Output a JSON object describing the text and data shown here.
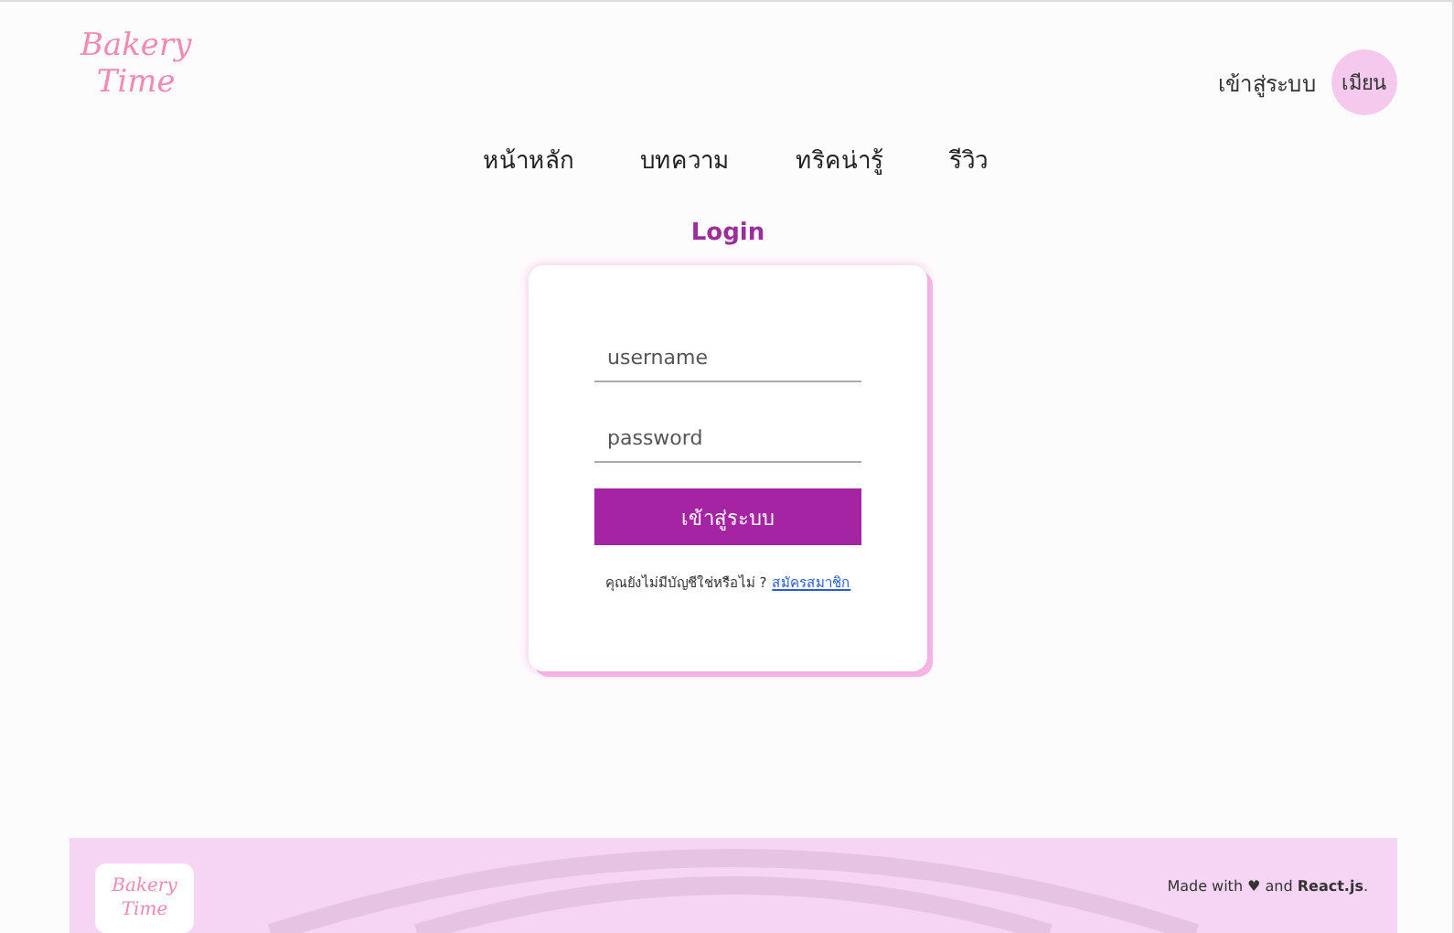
{
  "header": {
    "logo": [
      "Bakery",
      "Time"
    ],
    "login_link": "เข้าสู่ระบบ",
    "avatar": "เมียน"
  },
  "nav": [
    {
      "label": "หน้าหลัก"
    },
    {
      "label": "บทความ"
    },
    {
      "label": "ทริคน่ารู้"
    },
    {
      "label": "รีวิว"
    }
  ],
  "login": {
    "title": "Login",
    "username": {
      "placeholder": "username"
    },
    "password": {
      "placeholder": "password"
    },
    "submit": "เข้าสู่ระบบ",
    "signup_prompt": "คุณยังไม่มีบัญชีใช่หรือไม่ ?",
    "signup_link": "สมัครสมาชิก"
  },
  "footer": {
    "logo": [
      "Bakery",
      "Time"
    ],
    "credit": "Made with ♥ and **React.js**."
  }
}
